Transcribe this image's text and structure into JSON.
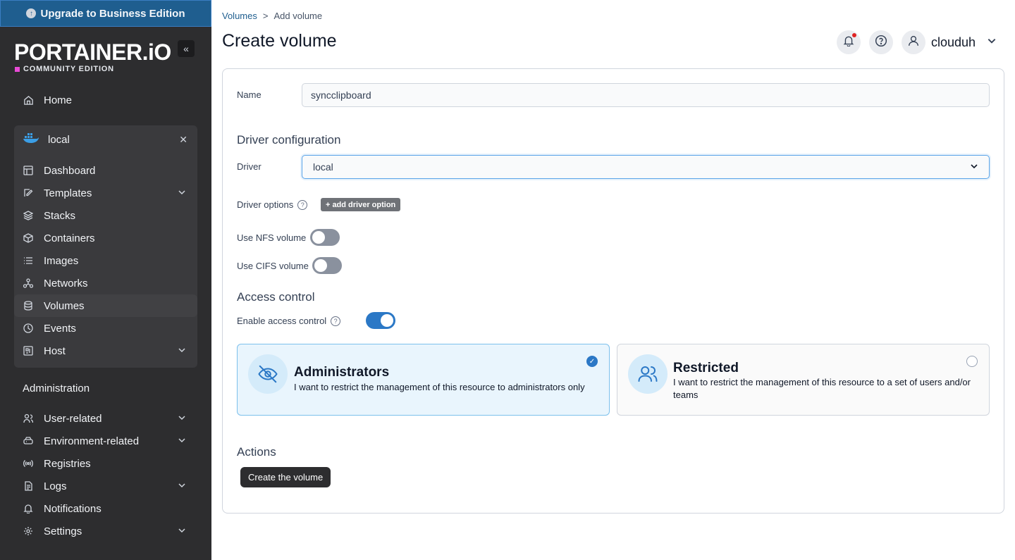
{
  "sidebar": {
    "upgrade_label": "Upgrade to Business Edition",
    "logo_text": "PORTAINER.iO",
    "edition_label": "COMMUNITY EDITION",
    "home_label": "Home",
    "environment": {
      "name": "local",
      "items": [
        {
          "label": "Dashboard"
        },
        {
          "label": "Templates"
        },
        {
          "label": "Stacks"
        },
        {
          "label": "Containers"
        },
        {
          "label": "Images"
        },
        {
          "label": "Networks"
        },
        {
          "label": "Volumes"
        },
        {
          "label": "Events"
        },
        {
          "label": "Host"
        }
      ]
    },
    "admin_header": "Administration",
    "admin_items": [
      {
        "label": "User-related"
      },
      {
        "label": "Environment-related"
      },
      {
        "label": "Registries"
      },
      {
        "label": "Logs"
      },
      {
        "label": "Notifications"
      },
      {
        "label": "Settings"
      }
    ]
  },
  "header": {
    "breadcrumb": {
      "parent": "Volumes",
      "separator": ">",
      "current": "Add volume"
    },
    "title": "Create volume",
    "username": "clouduh"
  },
  "form": {
    "name_label": "Name",
    "name_value": "syncclipboard",
    "driver_config_title": "Driver configuration",
    "driver_label": "Driver",
    "driver_value": "local",
    "driver_options_label": "Driver options",
    "add_driver_option_label": "add driver option",
    "nfs_label": "Use NFS volume",
    "nfs_enabled": false,
    "cifs_label": "Use CIFS volume",
    "cifs_enabled": false,
    "access_control_title": "Access control",
    "enable_access_label": "Enable access control",
    "access_enabled": true,
    "options": {
      "administrators": {
        "title": "Administrators",
        "desc": "I want to restrict the management of this resource to administrators only",
        "selected": true
      },
      "restricted": {
        "title": "Restricted",
        "desc": "I want to restrict the management of this resource to a set of users and/or teams",
        "selected": false
      }
    },
    "actions_title": "Actions",
    "create_button_label": "Create the volume"
  },
  "colors": {
    "sidebar_bg": "#2d2d2f",
    "upgrade_bg": "#1f5e8f",
    "accent": "#2b78c6",
    "edition_square": "#e94bd6",
    "notif_dot": "#e02424"
  }
}
